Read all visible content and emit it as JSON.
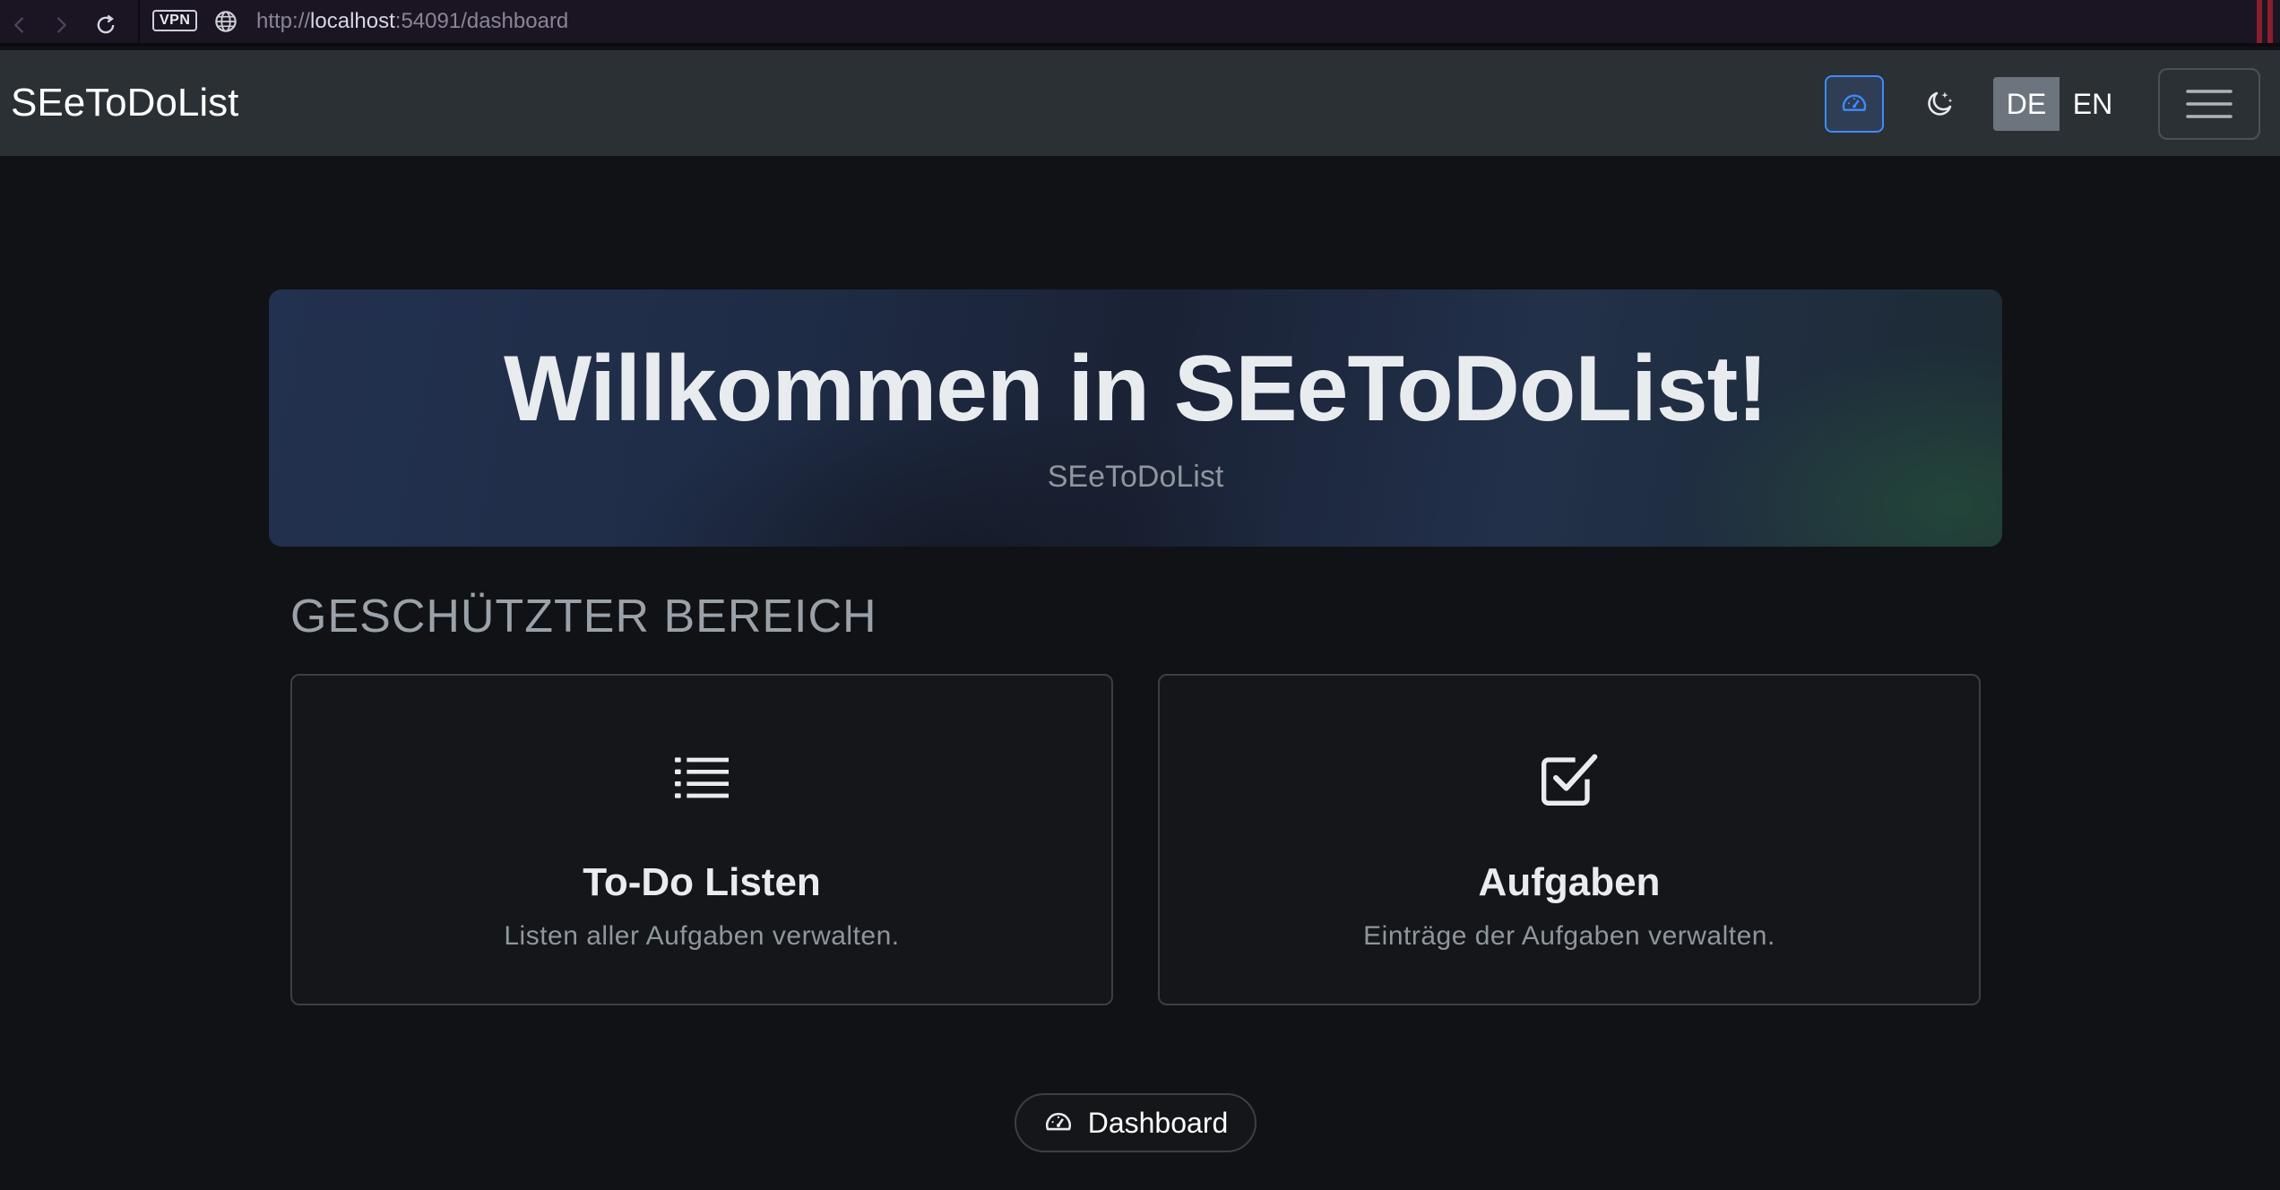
{
  "browser": {
    "vpn_label": "VPN",
    "url_prefix": "http://",
    "url_host": "localhost",
    "url_rest": ":54091/dashboard"
  },
  "navbar": {
    "brand": "SEeToDoList",
    "dashboard_icon": "speedometer-icon",
    "theme_icon": "moon-stars-icon",
    "lang_de": "DE",
    "lang_en": "EN",
    "active_lang": "DE",
    "menu_icon": "hamburger-menu-icon"
  },
  "hero": {
    "title": "Willkommen in SEeToDoList!",
    "subtitle": "SEeToDoList"
  },
  "section": {
    "title": "GESCHÜTZTER BEREICH"
  },
  "cards": [
    {
      "icon": "list-icon",
      "title": "To-Do Listen",
      "description": "Listen aller Aufgaben verwalten."
    },
    {
      "icon": "check-square-icon",
      "title": "Aufgaben",
      "description": "Einträge der Aufgaben verwalten."
    }
  ],
  "footer": {
    "dashboard_label": "Dashboard"
  },
  "colors": {
    "background": "#101216",
    "navbar": "#2b3035",
    "accent": "#3d8bfd",
    "active_lang_bg": "#6c757d"
  }
}
